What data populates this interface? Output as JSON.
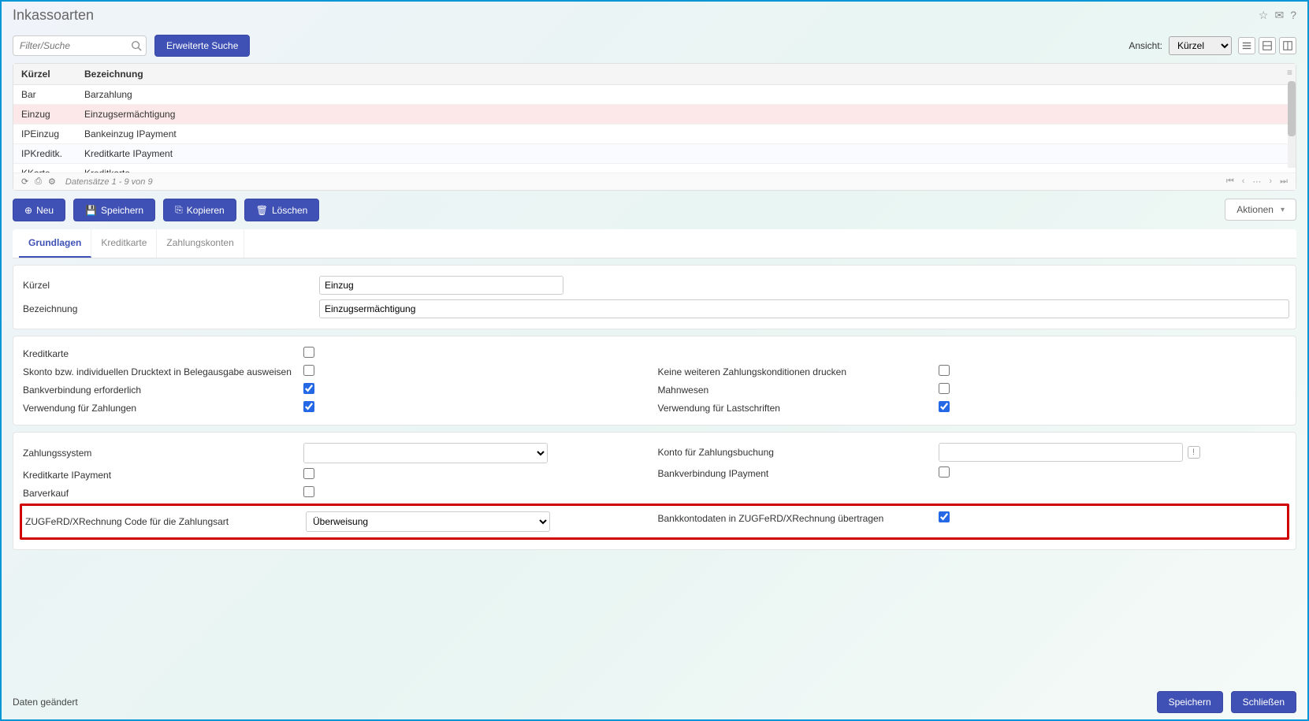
{
  "header": {
    "title": "Inkassoarten"
  },
  "search": {
    "placeholder": "Filter/Suche"
  },
  "toolbar": {
    "advanced_search": "Erweiterte Suche",
    "view_label": "Ansicht:",
    "view_selected": "Kürzel"
  },
  "grid": {
    "cols": [
      "Kürzel",
      "Bezeichnung"
    ],
    "rows": [
      {
        "k": "Bar",
        "b": "Barzahlung"
      },
      {
        "k": "Einzug",
        "b": "Einzugsermächtigung"
      },
      {
        "k": "IPEinzug",
        "b": "Bankeinzug IPayment"
      },
      {
        "k": "IPKreditk.",
        "b": "Kreditkarte IPayment"
      },
      {
        "k": "KKarte",
        "b": "Kreditkarte"
      }
    ],
    "status": "Datensätze 1 - 9 von 9"
  },
  "actions": {
    "new": "Neu",
    "save": "Speichern",
    "copy": "Kopieren",
    "delete": "Löschen",
    "more": "Aktionen"
  },
  "tabs": {
    "t1": "Grundlagen",
    "t2": "Kreditkarte",
    "t3": "Zahlungskonten"
  },
  "form": {
    "kurzel_lbl": "Kürzel",
    "kurzel_val": "Einzug",
    "bez_lbl": "Bezeichnung",
    "bez_val": "Einzugsermächtigung",
    "kreditkarte_lbl": "Kreditkarte",
    "skonto_lbl": "Skonto bzw. individuellen Drucktext in Belegausgabe ausweisen",
    "keine_lbl": "Keine weiteren Zahlungskonditionen drucken",
    "bank_req_lbl": "Bankverbindung erforderlich",
    "mahn_lbl": "Mahnwesen",
    "verw_zahl_lbl": "Verwendung für Zahlungen",
    "verw_last_lbl": "Verwendung für Lastschriften",
    "zahlsys_lbl": "Zahlungssystem",
    "konto_lbl": "Konto für Zahlungsbuchung",
    "kk_ipayment_lbl": "Kreditkarte IPayment",
    "bank_ipayment_lbl": "Bankverbindung IPayment",
    "barverkauf_lbl": "Barverkauf",
    "zugferd_code_lbl": "ZUGFeRD/XRechnung Code für die Zahlungsart",
    "zugferd_code_val": "Überweisung",
    "bank_zugferd_lbl": "Bankkontodaten in ZUGFeRD/XRechnung übertragen"
  },
  "footer": {
    "status": "Daten geändert",
    "save": "Speichern",
    "close": "Schließen"
  }
}
